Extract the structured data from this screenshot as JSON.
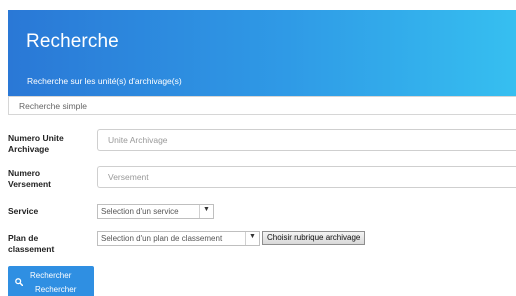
{
  "header": {
    "title": "Recherche",
    "subtitle": "Recherche sur les unité(s) d'archivage(s)"
  },
  "tabs": {
    "simple": "Recherche simple"
  },
  "form": {
    "numero_unite": {
      "label_line1": "Numero Unite",
      "label_line2": "Archivage",
      "placeholder": "Unite Archivage"
    },
    "numero_versement": {
      "label_line1": "Numero",
      "label_line2": "Versement",
      "placeholder": "Versement"
    },
    "service": {
      "label": "Service",
      "selected": "Selection d'un service",
      "caret_icon": "chevron-down-icon"
    },
    "plan": {
      "label_line1": "Plan de",
      "label_line2": "classement",
      "selected": "Selection d'un plan de classement",
      "caret_icon": "chevron-down-icon",
      "button": "Choisir rubrique archivage"
    }
  },
  "actions": {
    "search_line1": "Rechercher",
    "search_line2": "Rechercher",
    "search_icon": "search-icon"
  },
  "colors": {
    "header_gradient_start": "#2a78d6",
    "header_gradient_end": "#36bff0",
    "primary_button": "#2f8fe2"
  }
}
